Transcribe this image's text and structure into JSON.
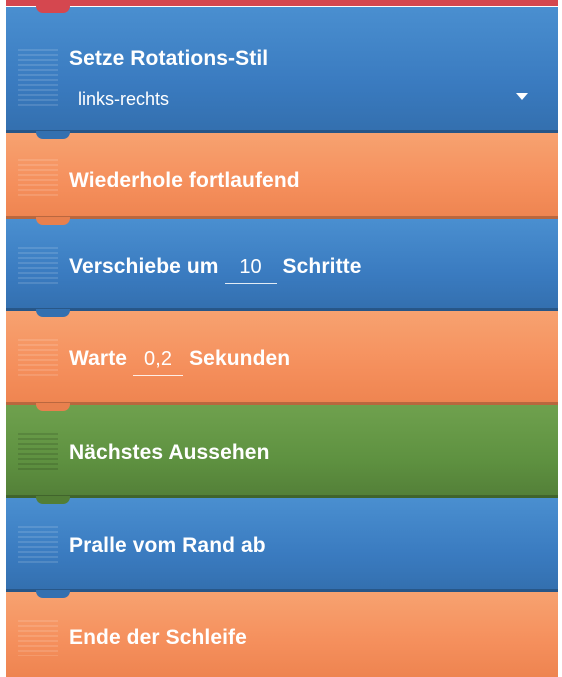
{
  "blocks": [
    {
      "id": "set-rotation-style",
      "color": "blue",
      "label": "Setze Rotations-Stil",
      "dropdown_value": "links-rechts"
    },
    {
      "id": "repeat-forever",
      "color": "orange",
      "label": "Wiederhole fortlaufend"
    },
    {
      "id": "move-steps",
      "color": "blue",
      "label_before": "Verschiebe um",
      "value": "10",
      "label_after": "Schritte"
    },
    {
      "id": "wait-seconds",
      "color": "orange",
      "label_before": "Warte",
      "value": "0,2",
      "label_after": "Sekunden"
    },
    {
      "id": "next-look",
      "color": "green",
      "label": "Nächstes Aussehen"
    },
    {
      "id": "bounce-off-edge",
      "color": "blue",
      "label": "Pralle vom Rand ab"
    },
    {
      "id": "end-loop",
      "color": "orange",
      "label": "Ende der Schleife"
    }
  ],
  "colors": {
    "blue": "#3a7bc0",
    "orange": "#f58f5c",
    "green": "#5e9140",
    "red": "#d5474f"
  }
}
